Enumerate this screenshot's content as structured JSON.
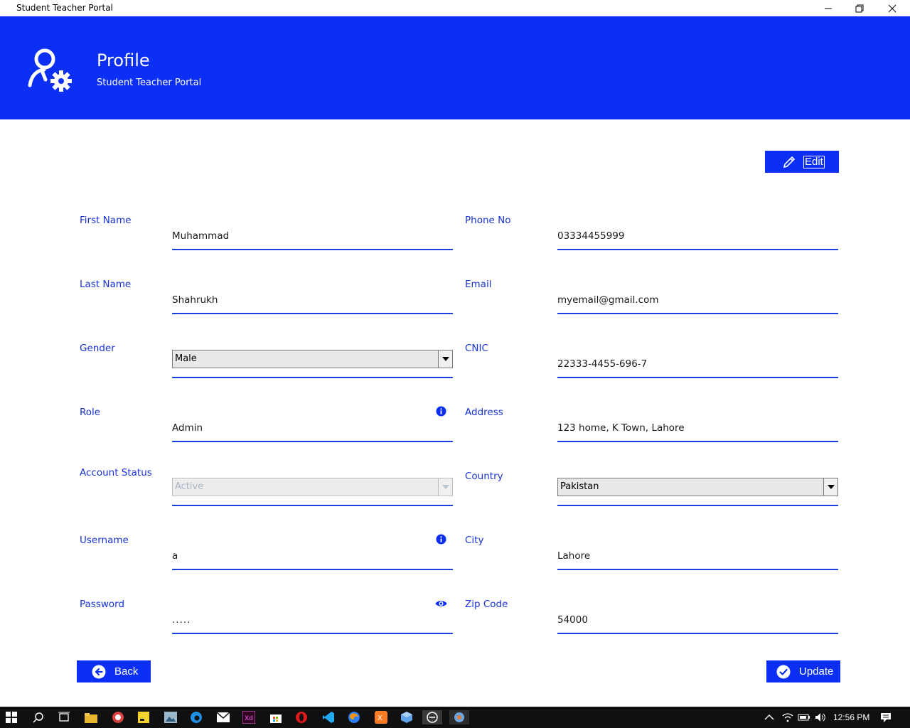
{
  "window": {
    "title": "Student Teacher Portal"
  },
  "header": {
    "title": "Profile",
    "subtitle": "Student Teacher Portal"
  },
  "actions": {
    "edit_label": "Edit",
    "back_label": "Back",
    "update_label": "Update"
  },
  "form": {
    "left": [
      {
        "label": "First Name",
        "value": "Muhammad"
      },
      {
        "label": "Last Name",
        "value": "Shahrukh"
      },
      {
        "label": "Gender",
        "value": "Male"
      },
      {
        "label": "Role",
        "value": "Admin"
      },
      {
        "label": "Account Status",
        "value": "Active"
      },
      {
        "label": "Username",
        "value": "a"
      },
      {
        "label": "Password",
        "value": "....."
      }
    ],
    "right": [
      {
        "label": "Phone No",
        "value": "03334455999"
      },
      {
        "label": "Email",
        "value": "myemail@gmail.com"
      },
      {
        "label": "CNIC",
        "value": "22333-4455-696-7"
      },
      {
        "label": "Address",
        "value": "123 home, K Town, Lahore"
      },
      {
        "label": "Country",
        "value": "Pakistan"
      },
      {
        "label": "City",
        "value": "Lahore"
      },
      {
        "label": "Zip Code",
        "value": "54000"
      }
    ]
  },
  "taskbar": {
    "clock": "12:56 PM"
  },
  "colors": {
    "accent": "#0b2ff4",
    "label": "#1832d8"
  },
  "icons": [
    "user-gear-icon",
    "pencil-icon",
    "info-icon",
    "eye-icon",
    "back-arrow-icon",
    "check-circle-icon"
  ]
}
